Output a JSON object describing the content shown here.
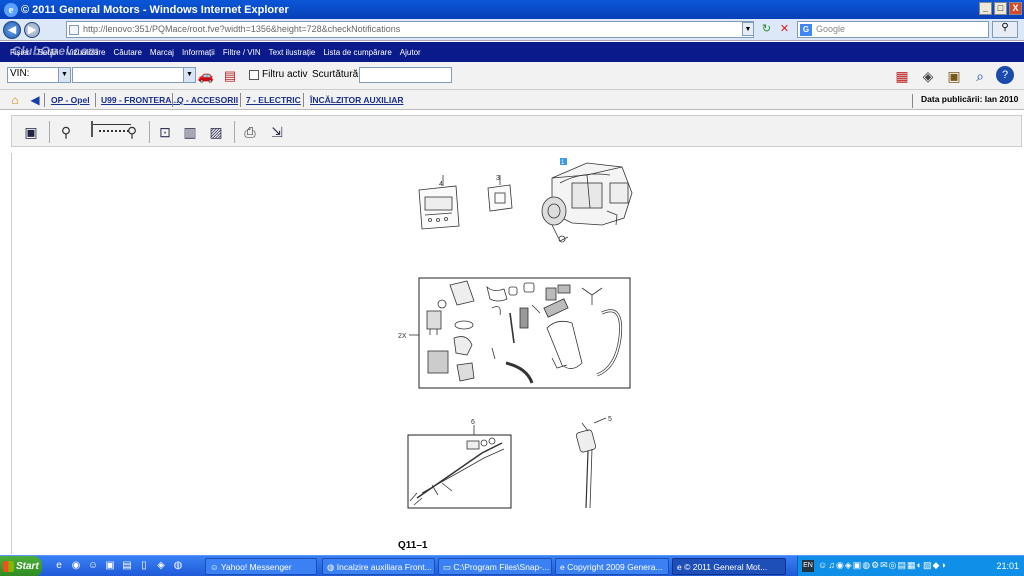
{
  "window": {
    "title": "© 2011 General Motors - Windows Internet Explorer",
    "controls": [
      "_",
      "□",
      "X"
    ]
  },
  "addressbar": {
    "url": "http://lenovo:351/PQMace/root.fve?width=1356&height=728&checkNotifications",
    "search_placeholder": "Google"
  },
  "watermark": "ClubOpel.com",
  "menu": {
    "items": [
      "Fișier",
      "Setări",
      "Vizualizare",
      "Căutare",
      "Marcaj",
      "Informații",
      "Filtre / VIN",
      "Text ilustrație",
      "Lista de cumpărare",
      "Ajutor"
    ]
  },
  "vinbar": {
    "vin_select_value": "VIN:",
    "filter_label": "Filtru activ",
    "shortcut_label": "Scurtătură:"
  },
  "breadcrumb": {
    "items": [
      "OP - Opel",
      "U99 - FRONTERA...",
      "Q - ACCESORII",
      "7 - ELECTRIC",
      "ÎNCĂLZITOR AUXILIAR"
    ],
    "pubdate": "Data publicării: Ian 2010"
  },
  "diagram": {
    "label": "Q11–1",
    "callouts": {
      "heater": "1",
      "kit": "2X",
      "switch": "3",
      "timer": "4",
      "sensor": "5",
      "harness": "6"
    }
  },
  "taskbar": {
    "start": "Start",
    "items": [
      "Yahoo! Messenger",
      "Incalzire auxiliara Front...",
      "C:\\Program Files\\Snap-...",
      "Copyright 2009 Genera...",
      "© 2011 General Mot..."
    ],
    "lang": "EN",
    "clock": "21:01"
  },
  "colors": {
    "titlebar": "#0a57d8",
    "menubar": "#0a1a8a",
    "taskbar": "#3a80f5",
    "start": "#4cae3a"
  }
}
